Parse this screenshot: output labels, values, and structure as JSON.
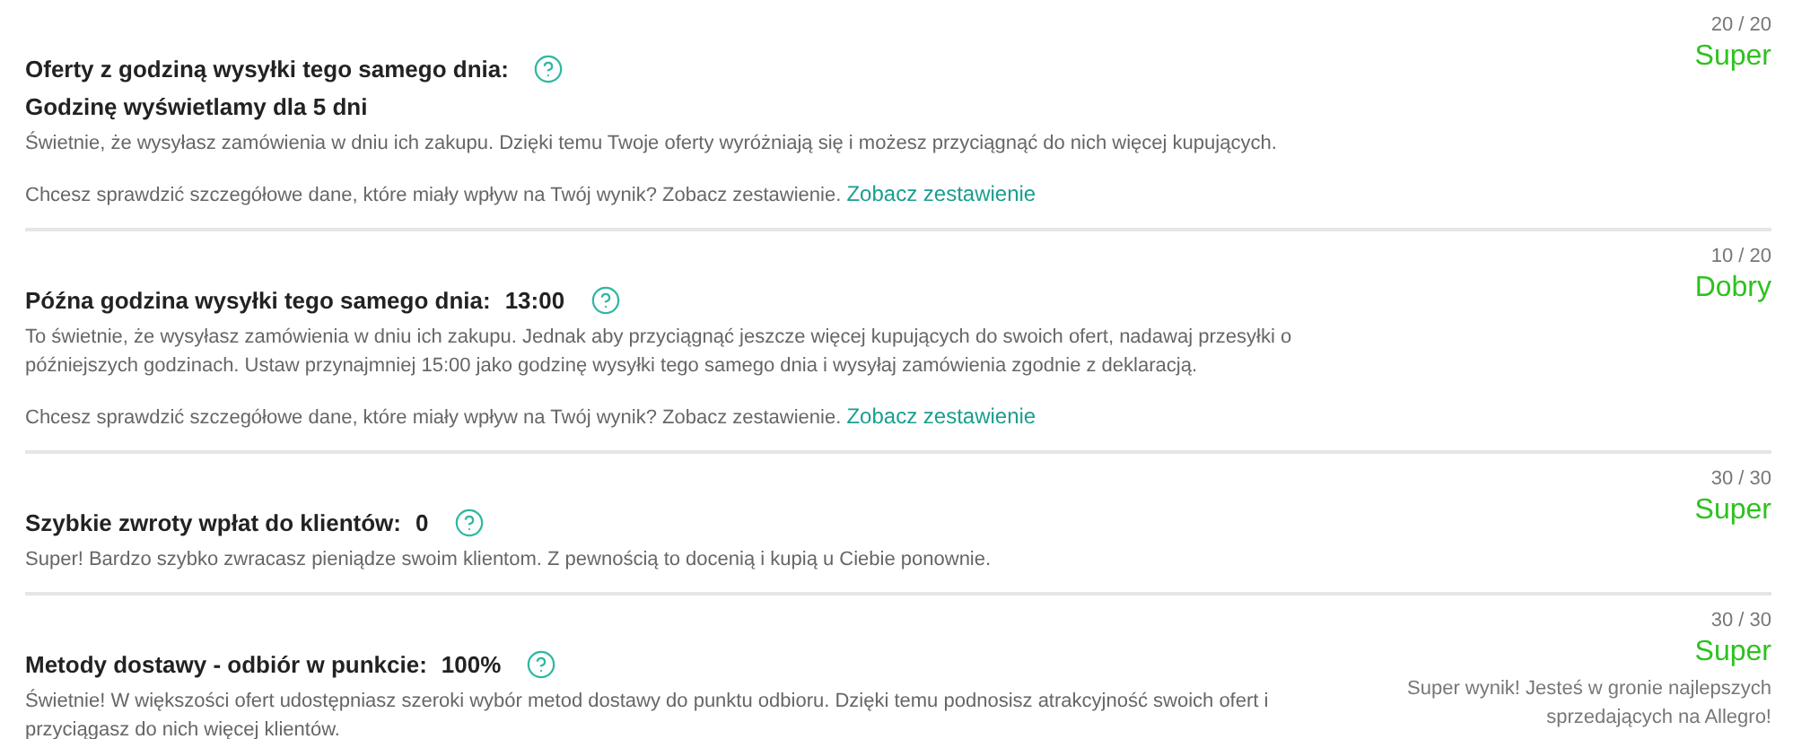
{
  "sections": [
    {
      "title": "Oferty z godziną wysyłki tego samego dnia:",
      "subheading": "Godzinę wyświetlamy dla 5 dni",
      "description": "Świetnie, że wysyłasz zamówienia w dniu ich zakupu. Dzięki temu Twoje oferty wyróżniają się i możesz przyciągnąć do nich więcej kupujących.",
      "link_prompt": "Chcesz sprawdzić szczegółowe dane, które miały wpływ na Twój wynik? Zobacz zestawienie.",
      "link": "Zobacz zestawienie",
      "score": "20 / 20",
      "rating": "Super"
    },
    {
      "title": "Późna godzina wysyłki tego samego dnia:",
      "value": "13:00",
      "description": "To świetnie, że wysyłasz zamówienia w dniu ich zakupu. Jednak aby przyciągnąć jeszcze więcej kupujących do swoich ofert, nadawaj przesyłki o późniejszych godzinach. Ustaw przynajmniej 15:00 jako godzinę wysyłki tego samego dnia i wysyłaj zamówienia zgodnie z deklaracją.",
      "link_prompt": "Chcesz sprawdzić szczegółowe dane, które miały wpływ na Twój wynik? Zobacz zestawienie.",
      "link": "Zobacz zestawienie",
      "score": "10 / 20",
      "rating": "Dobry"
    },
    {
      "title": "Szybkie zwroty wpłat do klientów:",
      "value": "0",
      "description": "Super! Bardzo szybko zwracasz pieniądze swoim klientom. Z pewnością to docenią i kupią u Ciebie ponownie.",
      "score": "30 / 30",
      "rating": "Super"
    },
    {
      "title": "Metody dostawy - odbiór w punkcie:",
      "value": "100%",
      "description": "Świetnie! W większości ofert udostępniasz szeroki wybór metod dostawy do punktu odbioru. Dzięki temu podnosisz atrakcyjność swoich ofert i przyciągasz do nich więcej klientów.",
      "score": "30 / 30",
      "rating": "Super",
      "note": "Super wynik! Jesteś w gronie najlepszych sprzedających na Allegro!"
    }
  ]
}
